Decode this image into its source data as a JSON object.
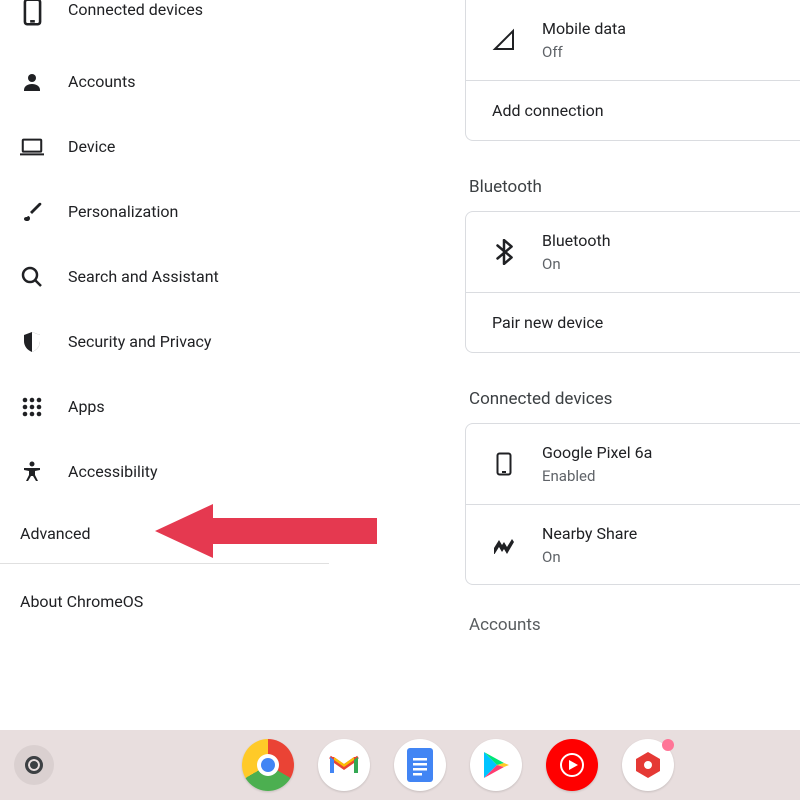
{
  "sidebar": {
    "items": [
      {
        "label": "Connected devices"
      },
      {
        "label": "Accounts"
      },
      {
        "label": "Device"
      },
      {
        "label": "Personalization"
      },
      {
        "label": "Search and Assistant"
      },
      {
        "label": "Security and Privacy"
      },
      {
        "label": "Apps"
      },
      {
        "label": "Accessibility"
      }
    ],
    "advanced": "Advanced",
    "about": "About ChromeOS"
  },
  "main": {
    "network": {
      "mobile_data": {
        "title": "Mobile data",
        "sub": "Off"
      },
      "add_connection": "Add connection"
    },
    "bluetooth": {
      "heading": "Bluetooth",
      "bluetooth_row": {
        "title": "Bluetooth",
        "sub": "On"
      },
      "pair_new": "Pair new device"
    },
    "connected_devices": {
      "heading": "Connected devices",
      "phone": {
        "title": "Google Pixel 6a",
        "sub": "Enabled"
      },
      "nearby": {
        "title": "Nearby Share",
        "sub": "On"
      }
    },
    "accounts": {
      "heading": "Accounts"
    }
  },
  "annotation": {
    "arrow_target": "Advanced"
  },
  "shelf": {
    "apps": [
      "chrome",
      "gmail",
      "docs",
      "play",
      "youtube-music",
      "hex-red"
    ]
  }
}
